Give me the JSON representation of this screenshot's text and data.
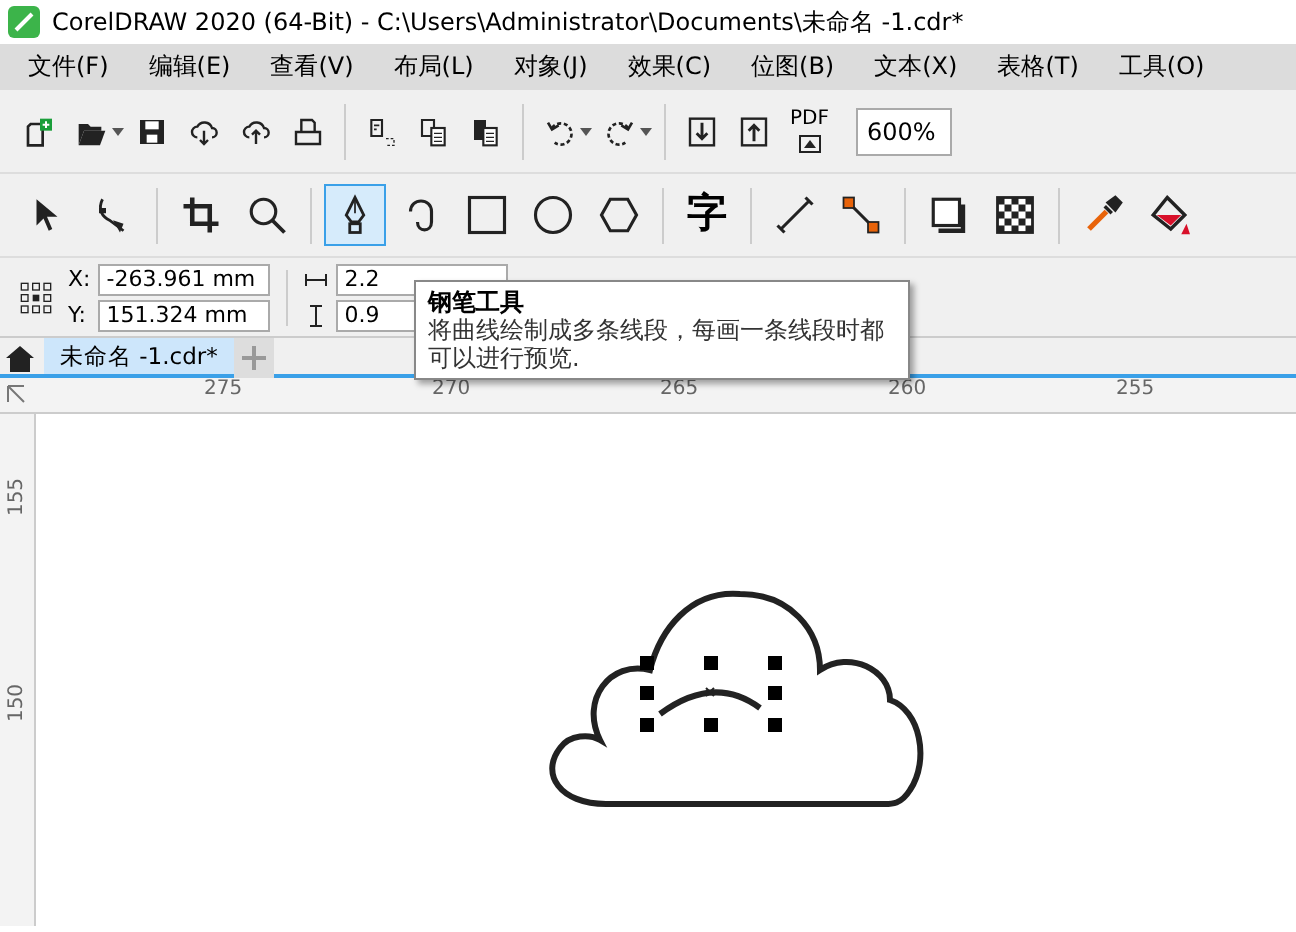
{
  "window": {
    "title": "CorelDRAW 2020 (64-Bit) - C:\\Users\\Administrator\\Documents\\未命名 -1.cdr*"
  },
  "menu": [
    "文件(F)",
    "编辑(E)",
    "查看(V)",
    "布局(L)",
    "对象(J)",
    "效果(C)",
    "位图(B)",
    "文本(X)",
    "表格(T)",
    "工具(O)"
  ],
  "standard_toolbar": {
    "tools": [
      {
        "kind": "new"
      },
      {
        "kind": "open"
      },
      {
        "kind": "save"
      },
      {
        "kind": "download"
      },
      {
        "kind": "upload"
      },
      {
        "kind": "print"
      },
      {
        "kind": "cut"
      },
      {
        "kind": "copy"
      },
      {
        "kind": "paste"
      },
      {
        "kind": "undo"
      },
      {
        "kind": "redo"
      },
      {
        "kind": "import"
      },
      {
        "kind": "export"
      },
      {
        "kind": "pdf"
      }
    ],
    "pdf_label": "PDF",
    "zoom": "600%"
  },
  "toolbox": [
    {
      "kind": "pick",
      "selected": false
    },
    {
      "kind": "shape",
      "selected": false
    },
    {
      "kind": "crop",
      "selected": false
    },
    {
      "kind": "zoom",
      "selected": false
    },
    {
      "kind": "pen",
      "selected": true
    },
    {
      "kind": "curve",
      "selected": false
    },
    {
      "kind": "rect",
      "selected": false
    },
    {
      "kind": "ellipse",
      "selected": false
    },
    {
      "kind": "polygon",
      "selected": false
    },
    {
      "kind": "text",
      "selected": false
    },
    {
      "kind": "dimension",
      "selected": false
    },
    {
      "kind": "connector",
      "selected": false
    },
    {
      "kind": "shadow",
      "selected": false
    },
    {
      "kind": "transparency",
      "selected": false
    },
    {
      "kind": "eyedropper",
      "selected": false
    },
    {
      "kind": "fill",
      "selected": false
    }
  ],
  "text_tool_glyph": "字",
  "property_bar": {
    "x_label": "X:",
    "x_value": "-263.961 mm",
    "y_label": "Y:",
    "y_value": "151.324 mm",
    "width_value": "2.2",
    "height_value": "0.9"
  },
  "tabs": [
    {
      "label": "未命名 -1.cdr*",
      "selected": true
    }
  ],
  "ruler": {
    "horizontal": [
      "275",
      "270",
      "265",
      "260",
      "255"
    ],
    "vertical": [
      "155",
      "150"
    ]
  },
  "tooltip": {
    "title": "钢笔工具",
    "description": "将曲线绘制成多条线段，每画一条线段时都可以进行预览."
  }
}
